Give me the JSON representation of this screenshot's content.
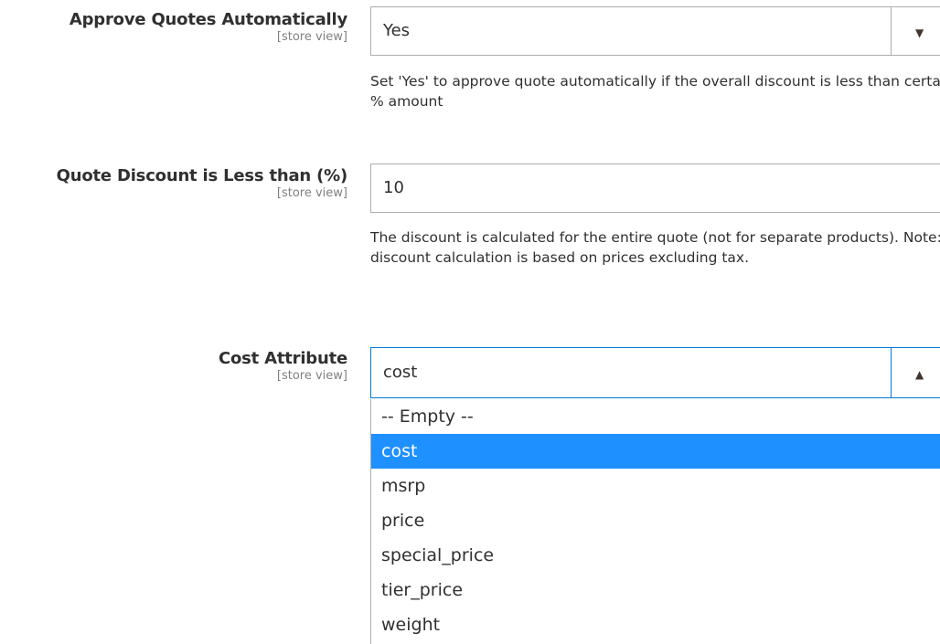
{
  "approve_quotes": {
    "label": "Approve Quotes Automatically",
    "scope": "[store view]",
    "value": "Yes",
    "note": "Set 'Yes' to approve quote automatically if the overall discount is less than certain % amount"
  },
  "quote_discount": {
    "label": "Quote Discount is Less than (%)",
    "scope": "[store view]",
    "value": "10",
    "note": "The discount is calculated for the entire quote (not for separate products). Note: discount calculation is based on prices excluding tax."
  },
  "cost_attribute": {
    "label": "Cost Attribute",
    "scope": "[store view]",
    "value": "cost",
    "options": [
      "-- Empty --",
      "cost",
      "msrp",
      "price",
      "special_price",
      "tier_price",
      "weight"
    ],
    "selected_option": "cost"
  },
  "icons": {
    "dropdown_closed": "chevron-down-icon",
    "dropdown_open": "chevron-up-icon"
  },
  "colors": {
    "selected_option_bg": "#1e90ff",
    "focus_border": "#007bdb"
  }
}
